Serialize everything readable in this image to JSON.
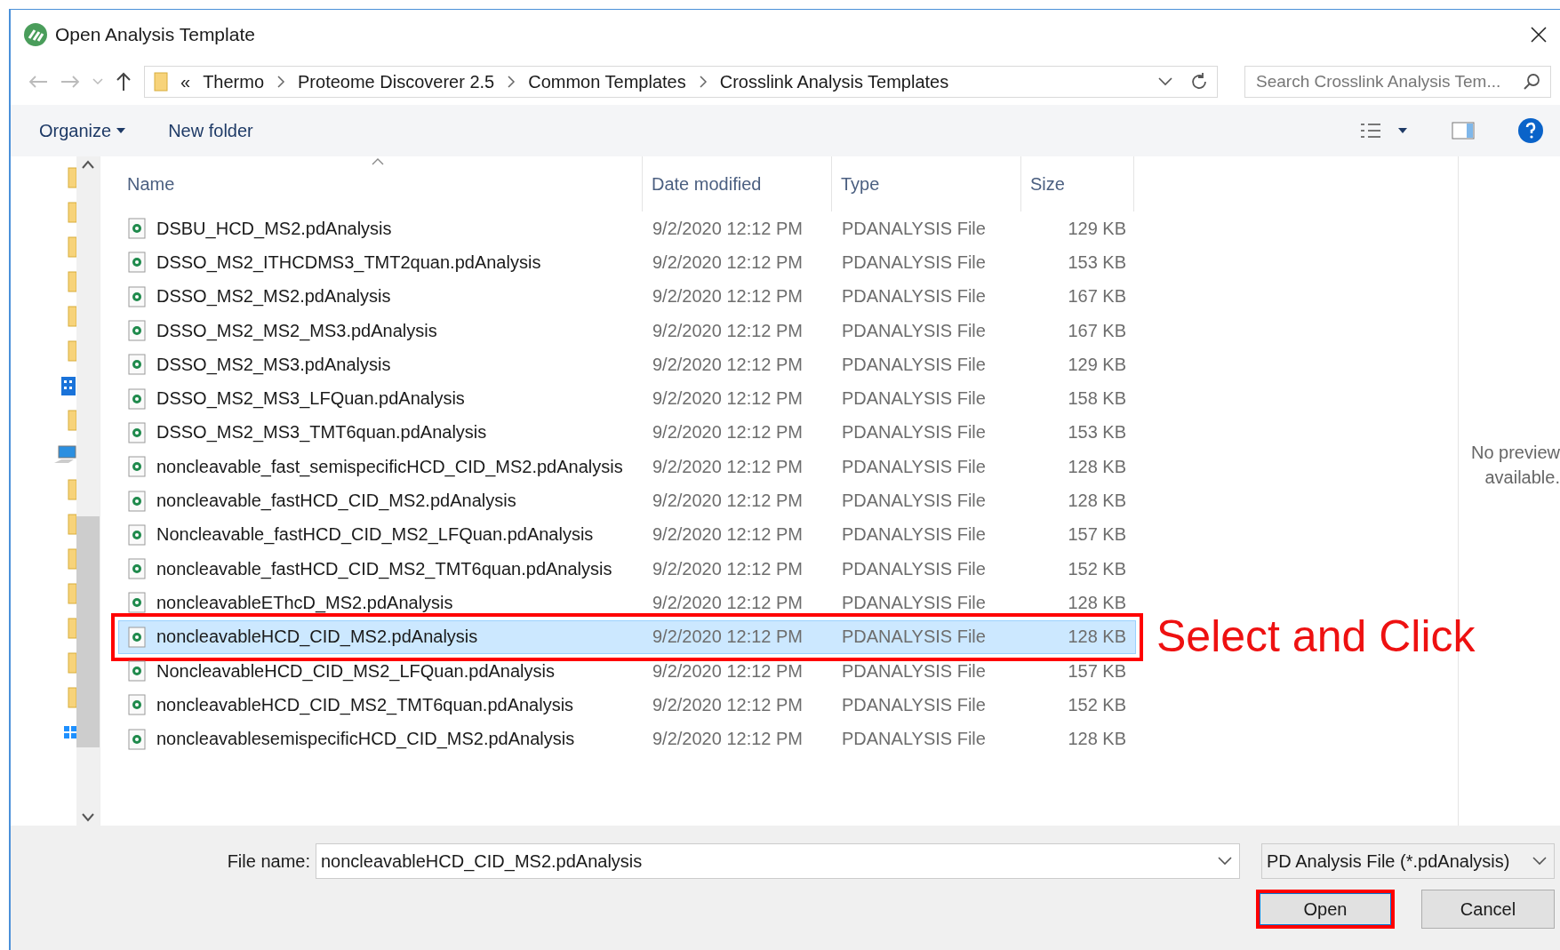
{
  "window": {
    "title": "Open Analysis Template"
  },
  "breadcrumb": {
    "overflow": "«",
    "segments": [
      "Thermo",
      "Proteome Discoverer 2.5",
      "Common Templates",
      "Crosslink Analysis Templates"
    ]
  },
  "search": {
    "placeholder": "Search Crosslink Analysis Tem..."
  },
  "toolbar": {
    "organize": "Organize",
    "new_folder": "New folder"
  },
  "nav_items": [
    {
      "kind": "folder"
    },
    {
      "kind": "folder"
    },
    {
      "kind": "folder"
    },
    {
      "kind": "folder"
    },
    {
      "kind": "folder"
    },
    {
      "kind": "folder"
    },
    {
      "kind": "building"
    },
    {
      "kind": "folder"
    },
    {
      "kind": "computer"
    },
    {
      "kind": "folder"
    },
    {
      "kind": "folder"
    },
    {
      "kind": "folder"
    },
    {
      "kind": "folder"
    },
    {
      "kind": "folder"
    },
    {
      "kind": "folder"
    },
    {
      "kind": "folder"
    },
    {
      "kind": "windows"
    }
  ],
  "columns": [
    "Name",
    "Date modified",
    "Type",
    "Size"
  ],
  "rows": [
    {
      "name": "DSBU_HCD_MS2.pdAnalysis",
      "date": "9/2/2020 12:12 PM",
      "type": "PDANALYSIS File",
      "size": "129 KB",
      "selected": false,
      "outlined": false
    },
    {
      "name": "DSSO_MS2_ITHCDMS3_TMT2quan.pdAnalysis",
      "date": "9/2/2020 12:12 PM",
      "type": "PDANALYSIS File",
      "size": "153 KB",
      "selected": false,
      "outlined": false
    },
    {
      "name": "DSSO_MS2_MS2.pdAnalysis",
      "date": "9/2/2020 12:12 PM",
      "type": "PDANALYSIS File",
      "size": "167 KB",
      "selected": false,
      "outlined": false
    },
    {
      "name": "DSSO_MS2_MS2_MS3.pdAnalysis",
      "date": "9/2/2020 12:12 PM",
      "type": "PDANALYSIS File",
      "size": "167 KB",
      "selected": false,
      "outlined": false
    },
    {
      "name": "DSSO_MS2_MS3.pdAnalysis",
      "date": "9/2/2020 12:12 PM",
      "type": "PDANALYSIS File",
      "size": "129 KB",
      "selected": false,
      "outlined": false
    },
    {
      "name": "DSSO_MS2_MS3_LFQuan.pdAnalysis",
      "date": "9/2/2020 12:12 PM",
      "type": "PDANALYSIS File",
      "size": "158 KB",
      "selected": false,
      "outlined": false
    },
    {
      "name": "DSSO_MS2_MS3_TMT6quan.pdAnalysis",
      "date": "9/2/2020 12:12 PM",
      "type": "PDANALYSIS File",
      "size": "153 KB",
      "selected": false,
      "outlined": false
    },
    {
      "name": "noncleavable_fast_semispecificHCD_CID_MS2.pdAnalysis",
      "date": "9/2/2020 12:12 PM",
      "type": "PDANALYSIS File",
      "size": "128 KB",
      "selected": false,
      "outlined": false
    },
    {
      "name": "noncleavable_fastHCD_CID_MS2.pdAnalysis",
      "date": "9/2/2020 12:12 PM",
      "type": "PDANALYSIS File",
      "size": "128 KB",
      "selected": false,
      "outlined": false
    },
    {
      "name": "Noncleavable_fastHCD_CID_MS2_LFQuan.pdAnalysis",
      "date": "9/2/2020 12:12 PM",
      "type": "PDANALYSIS File",
      "size": "157 KB",
      "selected": false,
      "outlined": false
    },
    {
      "name": "noncleavable_fastHCD_CID_MS2_TMT6quan.pdAnalysis",
      "date": "9/2/2020 12:12 PM",
      "type": "PDANALYSIS File",
      "size": "152 KB",
      "selected": false,
      "outlined": false
    },
    {
      "name": "noncleavableEThcD_MS2.pdAnalysis",
      "date": "9/2/2020 12:12 PM",
      "type": "PDANALYSIS File",
      "size": "128 KB",
      "selected": false,
      "outlined": false
    },
    {
      "name": "noncleavableHCD_CID_MS2.pdAnalysis",
      "date": "9/2/2020 12:12 PM",
      "type": "PDANALYSIS File",
      "size": "128 KB",
      "selected": true,
      "outlined": true
    },
    {
      "name": "NoncleavableHCD_CID_MS2_LFQuan.pdAnalysis",
      "date": "9/2/2020 12:12 PM",
      "type": "PDANALYSIS File",
      "size": "157 KB",
      "selected": false,
      "outlined": false
    },
    {
      "name": "noncleavableHCD_CID_MS2_TMT6quan.pdAnalysis",
      "date": "9/2/2020 12:12 PM",
      "type": "PDANALYSIS File",
      "size": "152 KB",
      "selected": false,
      "outlined": false
    },
    {
      "name": "noncleavablesemispecificHCD_CID_MS2.pdAnalysis",
      "date": "9/2/2020 12:12 PM",
      "type": "PDANALYSIS File",
      "size": "128 KB",
      "selected": false,
      "outlined": false
    }
  ],
  "annotation": {
    "text": "Select and Click"
  },
  "preview": {
    "lines": [
      "No preview",
      "available."
    ]
  },
  "file_name": {
    "label": "File name:",
    "value": "noncleavableHCD_CID_MS2.pdAnalysis"
  },
  "file_type": {
    "value": "PD Analysis File (*.pdAnalysis)"
  },
  "buttons": [
    {
      "label": "Open",
      "outlined": true
    },
    {
      "label": "Cancel",
      "outlined": false
    }
  ]
}
